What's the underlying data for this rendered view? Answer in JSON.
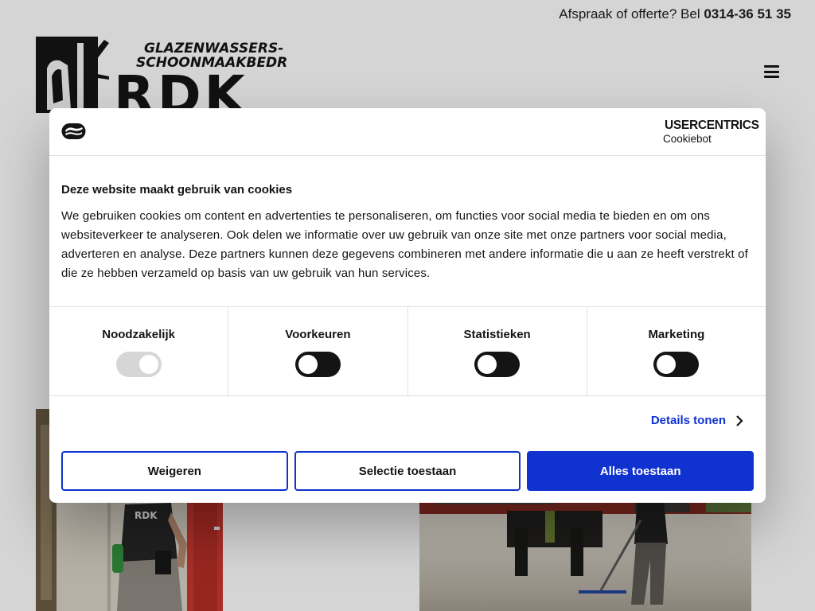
{
  "site": {
    "topbar_text": "Afspraak of offerte? Bel ",
    "topbar_phone": "0314-36 51 35",
    "logo": {
      "tagline_line1": "GLAZENWASSERS- EN",
      "tagline_line2": "SCHOONMAAKBEDRIJF",
      "wordmark": "RDK"
    },
    "menu_icon": "hamburger-icon",
    "photo_shirt_text": "RDK"
  },
  "cookie_dialog": {
    "brand_icon": "cookie-logo-icon",
    "provider": {
      "name": "USERCENTRICS",
      "product": "Cookiebot"
    },
    "title": "Deze website maakt gebruik van cookies",
    "description": "We gebruiken cookies om content en advertenties te personaliseren, om functies voor social media te bieden en om ons websiteverkeer te analyseren. Ook delen we informatie over uw gebruik van onze site met onze partners voor social media, adverteren en analyse. Deze partners kunnen deze gegevens combineren met andere informatie die u aan ze heeft verstrekt of die ze hebben verzameld op basis van uw gebruik van hun services.",
    "categories": [
      {
        "label": "Noodzakelijk",
        "checked": true,
        "disabled": true
      },
      {
        "label": "Voorkeuren",
        "checked": false,
        "disabled": false
      },
      {
        "label": "Statistieken",
        "checked": false,
        "disabled": false
      },
      {
        "label": "Marketing",
        "checked": false,
        "disabled": false
      }
    ],
    "details_label": "Details tonen",
    "buttons": {
      "deny": "Weigeren",
      "allow_selection": "Selectie toestaan",
      "allow_all": "Alles toestaan"
    },
    "colors": {
      "accent": "#1032cf",
      "text": "#141414",
      "toggle_off": "#141414",
      "toggle_disabled": "#d6d6d6"
    }
  }
}
